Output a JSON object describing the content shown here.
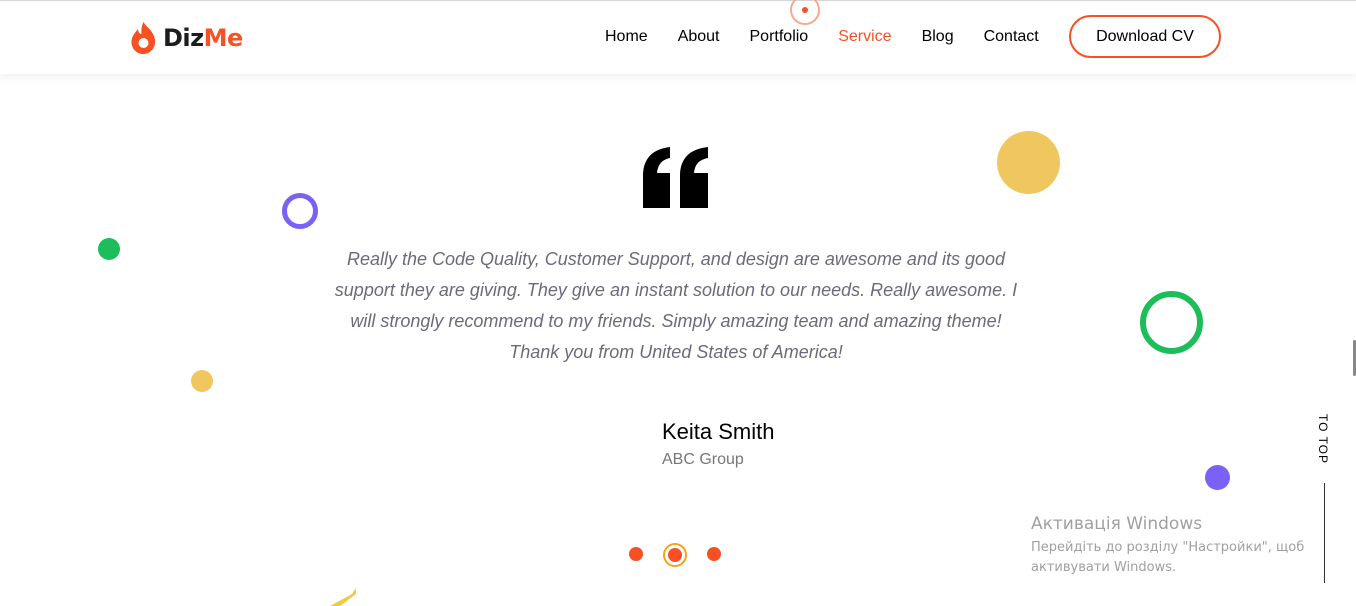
{
  "brand": {
    "name_part1": "Diz",
    "name_part2": "Me",
    "accent_color": "#f75023",
    "logo_icon": "flame-icon"
  },
  "nav": {
    "items": [
      {
        "label": "Home",
        "active": false
      },
      {
        "label": "About",
        "active": false
      },
      {
        "label": "Portfolio",
        "active": false
      },
      {
        "label": "Service",
        "active": true
      },
      {
        "label": "Blog",
        "active": false
      },
      {
        "label": "Contact",
        "active": false
      }
    ],
    "cta_label": "Download CV"
  },
  "testimonial": {
    "quote_icon": "quote-icon",
    "text": "Really the Code Quality, Customer Support, and design are awesome and its good support they are giving. They give an instant solution to our needs. Really awesome. I will strongly recommend to my friends. Simply amazing team and amazing theme! Thank you from United States of America!",
    "author": "Keita Smith",
    "company": "ABC Group"
  },
  "carousel": {
    "dot_count": 3,
    "active_index": 1
  },
  "to_top": {
    "label": "TO TOP"
  },
  "windows_watermark": {
    "title": "Активація Windows",
    "subtitle": "Перейдіть до розділу \"Настройки\", щоб активувати Windows."
  },
  "colors": {
    "yellow": "#f0c75e",
    "green": "#1cbe59",
    "purple": "#7b61f5",
    "text_gray": "#6b6b7b"
  }
}
